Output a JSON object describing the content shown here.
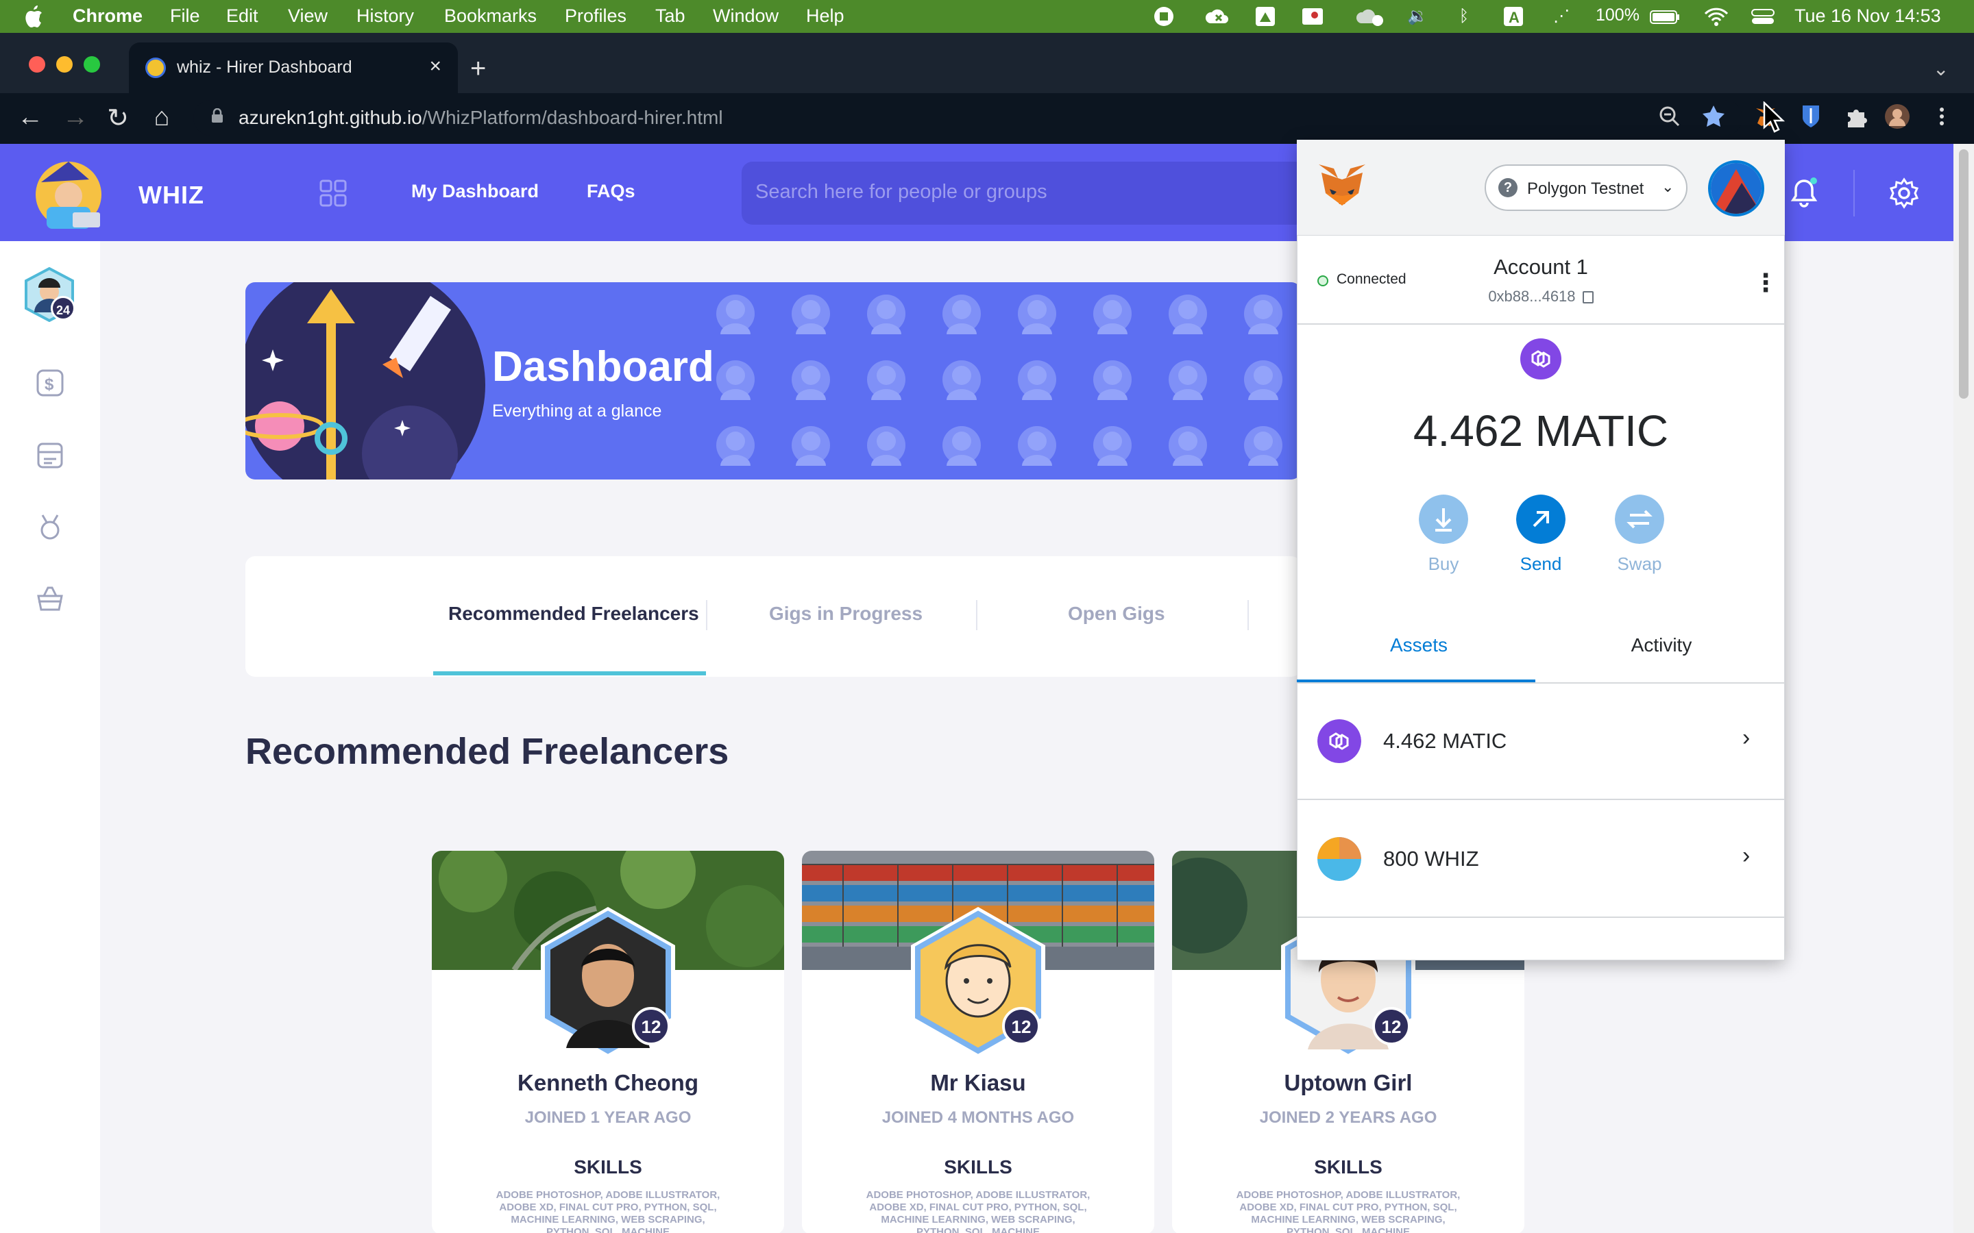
{
  "menubar": {
    "app": "Chrome",
    "items": [
      "File",
      "Edit",
      "View",
      "History",
      "Bookmarks",
      "Profiles",
      "Tab",
      "Window",
      "Help"
    ],
    "battery": "100%",
    "datetime": "Tue 16 Nov  14:53",
    "status_icons": [
      "stop-icon",
      "creative-cloud-icon",
      "drive-icon",
      "photo-icon",
      "cloud-icon",
      "volume-icon",
      "bluetooth-icon",
      "text-input-icon",
      "dots-icon",
      "battery-icon",
      "wifi-icon",
      "control-center-icon"
    ]
  },
  "browser": {
    "tab_title": "whiz - Hirer Dashboard",
    "tab_close": "×",
    "new_tab": "+",
    "url_host": "azurekn1ght.github.io",
    "url_path": "/WhizPlatform/dashboard-hirer.html"
  },
  "header": {
    "brand": "WHIZ",
    "nav": [
      "My Dashboard",
      "FAQs"
    ],
    "search_placeholder": "Search here for people or groups"
  },
  "sidebar": {
    "avatar_badge": "24",
    "icons": [
      "dollar-icon",
      "card-icon",
      "medal-icon",
      "basket-icon"
    ]
  },
  "banner": {
    "title": "Dashboard",
    "subtitle": "Everything at a glance"
  },
  "dashboard_tabs": [
    {
      "label": "Recommended Freelancers",
      "active": true
    },
    {
      "label": "Gigs in Progress",
      "active": false
    },
    {
      "label": "Open Gigs",
      "active": false
    }
  ],
  "section_title": "Recommended Freelancers",
  "freelancers": [
    {
      "name": "Kenneth Cheong",
      "joined": "JOINED 1 YEAR AGO",
      "level": "12",
      "skills_heading": "SKILLS",
      "skills": "ADOBE PHOTOSHOP, ADOBE ILLUSTRATOR, ADOBE XD, FINAL CUT PRO, PYTHON, SQL, MACHINE LEARNING, WEB SCRAPING, PYTHON, SQL, MACHINE"
    },
    {
      "name": "Mr Kiasu",
      "joined": "JOINED 4 MONTHS AGO",
      "level": "12",
      "skills_heading": "SKILLS",
      "skills": "ADOBE PHOTOSHOP, ADOBE ILLUSTRATOR, ADOBE XD, FINAL CUT PRO, PYTHON, SQL, MACHINE LEARNING, WEB SCRAPING, PYTHON, SQL, MACHINE"
    },
    {
      "name": "Uptown Girl",
      "joined": "JOINED 2 YEARS AGO",
      "level": "12",
      "skills_heading": "SKILLS",
      "skills": "ADOBE PHOTOSHOP, ADOBE ILLUSTRATOR, ADOBE XD, FINAL CUT PRO, PYTHON, SQL, MACHINE LEARNING, WEB SCRAPING, PYTHON, SQL, MACHINE"
    }
  ],
  "metamask": {
    "network": "Polygon Testnet",
    "network_help": "?",
    "status": "Connected",
    "account": "Account 1",
    "address": "0xb88...4618",
    "balance": "4.462 MATIC",
    "actions": [
      {
        "label": "Buy",
        "enabled": false
      },
      {
        "label": "Send",
        "enabled": true
      },
      {
        "label": "Swap",
        "enabled": false
      }
    ],
    "tabs": [
      {
        "label": "Assets",
        "active": true
      },
      {
        "label": "Activity",
        "active": false
      }
    ],
    "assets": [
      {
        "label": "4.462 MATIC",
        "icon": "matic-icon"
      },
      {
        "label": "800 WHIZ",
        "icon": "whiz-token-icon"
      }
    ],
    "colors": {
      "accent": "#037dd6",
      "matic": "#8247e5",
      "header": "#5b5cf0"
    }
  }
}
